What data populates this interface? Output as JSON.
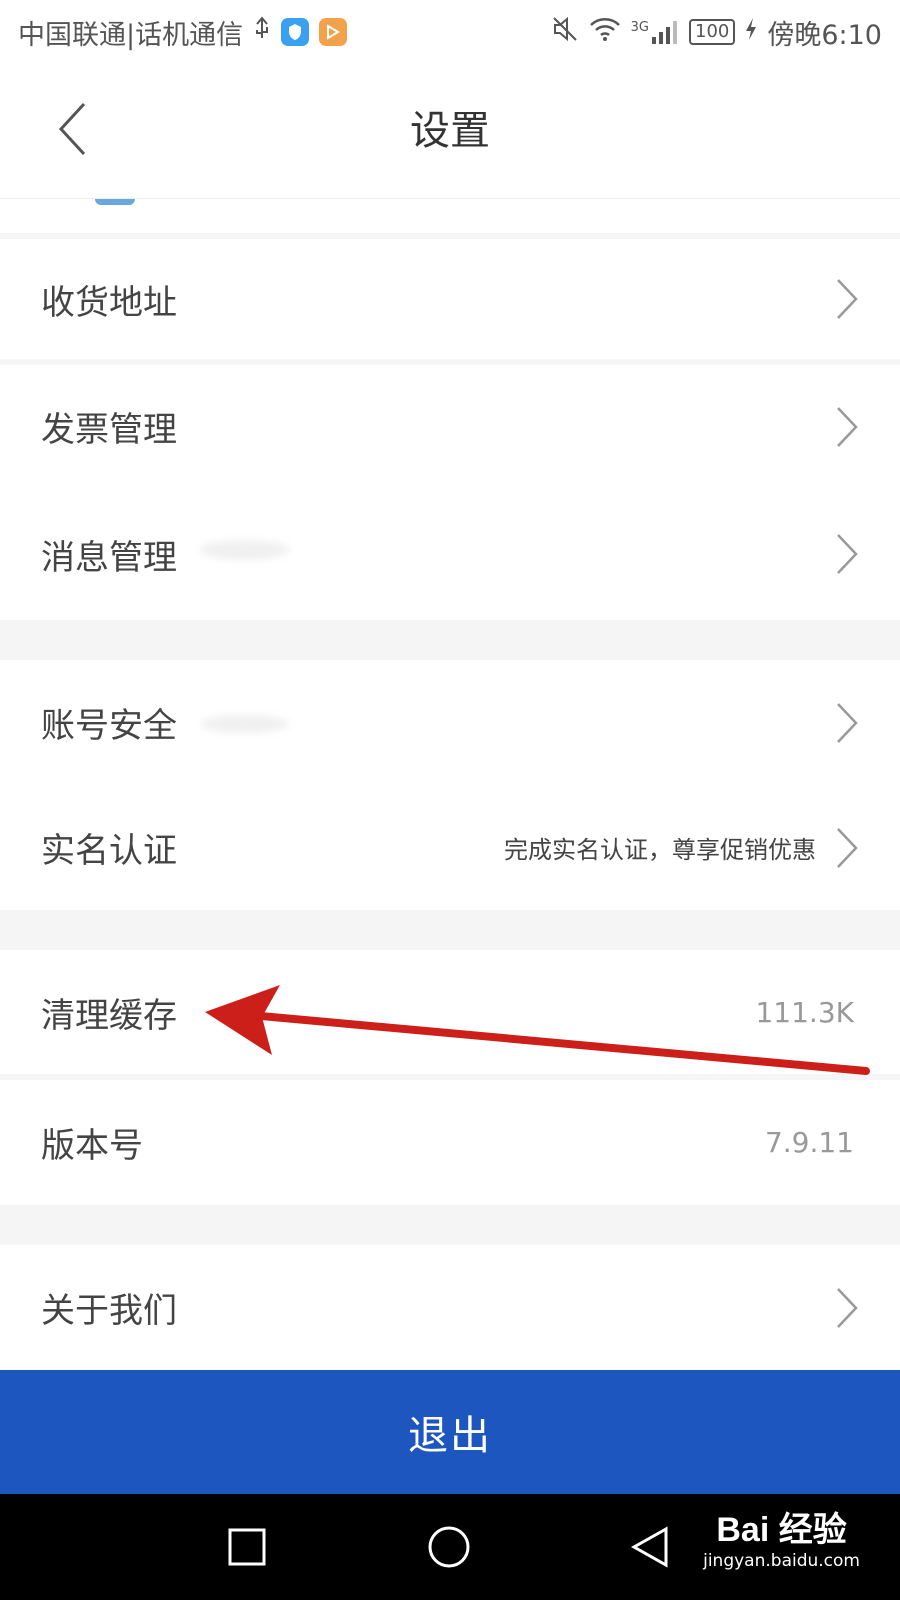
{
  "status_bar": {
    "carrier": "中国联通|话机通信",
    "network": "3G",
    "battery": "100",
    "time": "傍晚6:10"
  },
  "header": {
    "title": "设置"
  },
  "settings": {
    "shipping_address": "收货地址",
    "invoice_management": "发票管理",
    "message_management": "消息管理",
    "account_security": "账号安全",
    "real_name": "实名认证",
    "real_name_desc": "完成实名认证，尊享促销优惠",
    "clear_cache": "清理缓存",
    "cache_size": "111.3K",
    "version": "版本号",
    "version_value": "7.9.11",
    "about_us": "关于我们"
  },
  "logout_label": "退出",
  "watermark": {
    "logo": "Bai 经验",
    "url": "jingyan.baidu.com"
  },
  "colors": {
    "primary": "#1d56bf",
    "annotation_arrow": "#cc1f1a",
    "divider": "#f5f5f5"
  }
}
